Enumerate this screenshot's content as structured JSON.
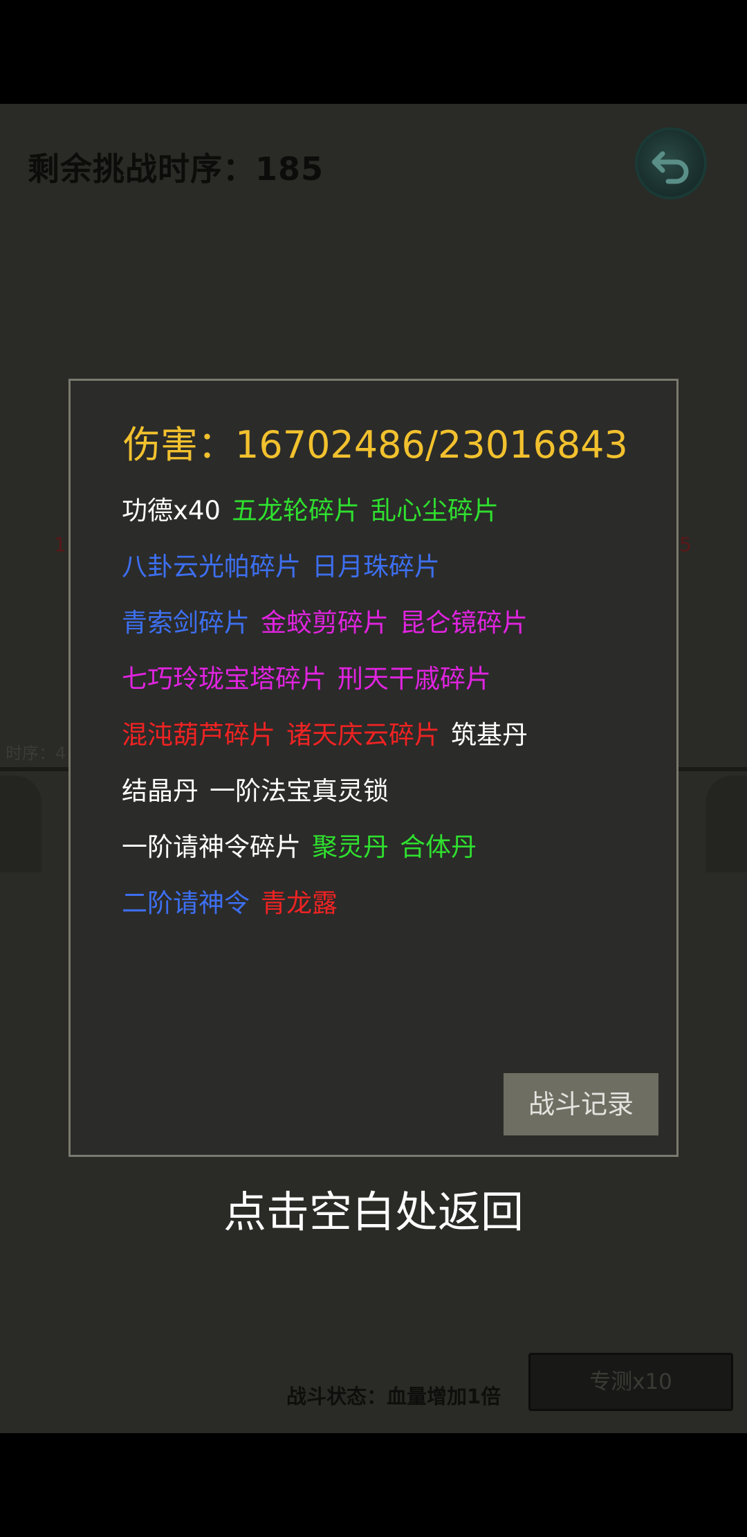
{
  "background": {
    "challenge_label": "剩余挑战时序：185",
    "timer_label": "时序：4",
    "left_red_mark": "1",
    "right_red_mark": "5",
    "battle_status": "战斗状态：血量增加1倍",
    "test_button": "专测x10"
  },
  "modal": {
    "damage_text": "伤害：16702486/23016843",
    "reward_lines": [
      [
        {
          "text": "功德x40",
          "color": "#ffffff"
        },
        {
          "text": "五龙轮碎片",
          "color": "#2fe02f"
        },
        {
          "text": "乱心尘碎片",
          "color": "#2fe02f"
        }
      ],
      [
        {
          "text": "八卦云光帕碎片",
          "color": "#3d6ff0"
        },
        {
          "text": "日月珠碎片",
          "color": "#3d6ff0"
        }
      ],
      [
        {
          "text": "青索剑碎片",
          "color": "#3d6ff0"
        },
        {
          "text": "金蛟剪碎片",
          "color": "#e024e0"
        },
        {
          "text": "昆仑镜碎片",
          "color": "#e024e0"
        }
      ],
      [
        {
          "text": "七巧玲珑宝塔碎片",
          "color": "#e024e0"
        },
        {
          "text": "刑天干戚碎片",
          "color": "#e024e0"
        }
      ],
      [
        {
          "text": "混沌葫芦碎片",
          "color": "#f02323"
        },
        {
          "text": "诸天庆云碎片",
          "color": "#f02323"
        },
        {
          "text": "筑基丹",
          "color": "#ffffff"
        }
      ],
      [
        {
          "text": "结晶丹",
          "color": "#ffffff"
        },
        {
          "text": "一阶法宝真灵锁",
          "color": "#ffffff"
        }
      ],
      [
        {
          "text": "一阶请神令碎片",
          "color": "#ffffff"
        },
        {
          "text": "聚灵丹",
          "color": "#2fe02f"
        },
        {
          "text": "合体丹",
          "color": "#2fe02f"
        }
      ],
      [
        {
          "text": "二阶请神令",
          "color": "#3d6ff0"
        },
        {
          "text": "青龙露",
          "color": "#f02323"
        }
      ]
    ],
    "battle_log_button": "战斗记录"
  },
  "hint_text": "点击空白处返回",
  "icons": {
    "back": "back-arrow-icon"
  }
}
